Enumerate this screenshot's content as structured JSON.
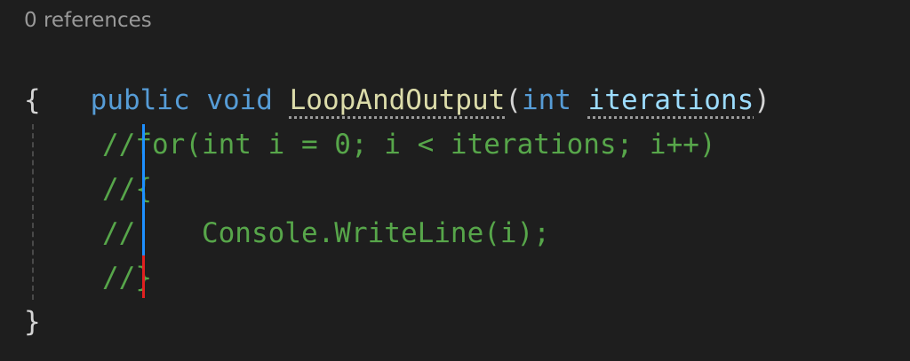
{
  "codelens": {
    "references": "0 references"
  },
  "signature": {
    "modifier": "public",
    "return_type": "void",
    "method": "LoopAndOutput",
    "open_paren": "(",
    "param_type": "int",
    "param_name": "iterations",
    "close_paren": ")"
  },
  "braces": {
    "open": "{",
    "close": "}"
  },
  "comment_lines": [
    {
      "marker": "//",
      "text": "for(int i = 0; i < iterations; i++)"
    },
    {
      "marker": "//",
      "text": "{"
    },
    {
      "marker": "//",
      "text": "    Console.WriteLine(i);"
    },
    {
      "marker": "//",
      "text": "}"
    }
  ],
  "colors": {
    "background": "#1e1e1e",
    "keyword": "#569cd6",
    "method": "#dcdcaa",
    "parameter": "#9cdcfe",
    "comment": "#57a64a",
    "change_bar_blue": "#1e90ff",
    "change_bar_red": "#e02020"
  }
}
